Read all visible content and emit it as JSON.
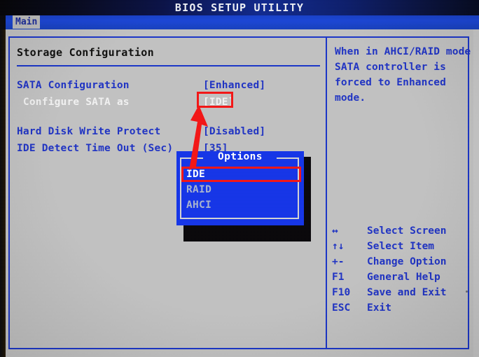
{
  "titlebar": {
    "title": "BIOS SETUP UTILITY"
  },
  "menubar": {
    "tabs": [
      {
        "label": "Main",
        "active": true
      }
    ]
  },
  "left_panel": {
    "section_title": "Storage Configuration",
    "rows": [
      {
        "label": "SATA Configuration",
        "value": "[Enhanced]",
        "label_color": "blue",
        "value_color": "blue"
      },
      {
        "label": " Configure SATA as",
        "value": "[IDE]",
        "label_color": "white",
        "value_color": "white"
      },
      {
        "label": "Hard Disk Write Protect",
        "value": "[Disabled]",
        "label_color": "blue",
        "value_color": "blue"
      },
      {
        "label": "IDE Detect Time Out (Sec)",
        "value": "[35]",
        "label_color": "blue",
        "value_color": "blue"
      }
    ]
  },
  "options_popup": {
    "title": "Options",
    "items": [
      {
        "label": "IDE",
        "selected": true
      },
      {
        "label": "RAID",
        "selected": false
      },
      {
        "label": "AHCI",
        "selected": false
      }
    ]
  },
  "right_panel": {
    "help_lines": [
      "When in AHCI/RAID mode",
      "SATA controller is",
      "forced to Enhanced",
      "mode."
    ],
    "key_legend": [
      {
        "key": "↔",
        "desc": "Select Screen"
      },
      {
        "key": "↑↓",
        "desc": "Select Item"
      },
      {
        "key": "+-",
        "desc": "Change Option"
      },
      {
        "key": "F1",
        "desc": "General Help"
      },
      {
        "key": "F10",
        "desc": "Save and Exit"
      },
      {
        "key": "ESC",
        "desc": "Exit"
      }
    ]
  },
  "annotations": {
    "color": "#f41616",
    "highlight_value": "[IDE]",
    "highlight_option": "IDE",
    "arrow_from": "options-popup-ide-item",
    "arrow_to": "configure-sata-as-value"
  },
  "colors": {
    "screen_background": "#c2c2c2",
    "title_bar": "#0a1248",
    "menu_bar": "#1b46d6",
    "frame_border": "#1a35c8",
    "text_blue": "#1f33c4",
    "text_white": "#f2f2f2",
    "popup_background": "#1535e8",
    "annotation_red": "#f41616"
  }
}
